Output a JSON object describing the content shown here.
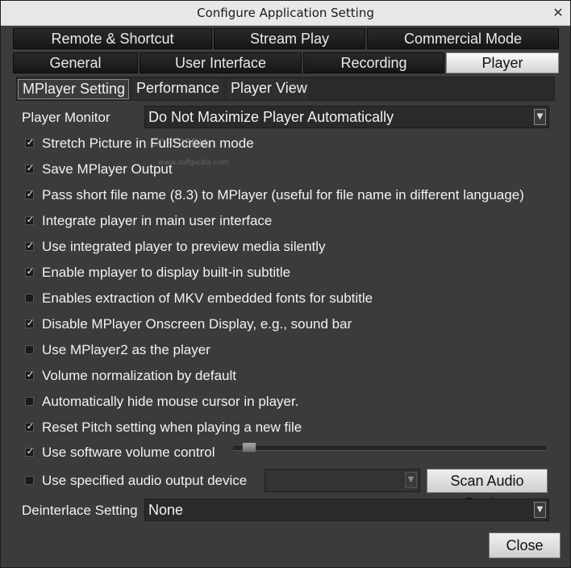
{
  "window": {
    "title": "Configure Application Setting",
    "close_glyph": "✕"
  },
  "tabs_row1": [
    "Remote & Shortcut",
    "Stream Play",
    "Commercial Mode"
  ],
  "tabs_row2": [
    "General",
    "User Interface",
    "Recording",
    "Player"
  ],
  "active_tab": "Player",
  "subtabs": [
    "MPlayer Setting",
    "Performance",
    "Player View"
  ],
  "active_subtab": "MPlayer Setting",
  "player_monitor": {
    "label": "Player Monitor",
    "value": "Do Not Maximize Player Automatically"
  },
  "options": [
    {
      "label": "Stretch Picture in FullScreen mode",
      "checked": true
    },
    {
      "label": "Save MPlayer Output",
      "checked": true
    },
    {
      "label": "Pass short file name (8.3) to MPlayer (useful for file name in different language)",
      "checked": true
    },
    {
      "label": "Integrate player in main user interface",
      "checked": true
    },
    {
      "label": "Use integrated player to preview media silently",
      "checked": true
    },
    {
      "label": "Enable mplayer to display built-in subtitle",
      "checked": true
    },
    {
      "label": "Enables extraction of MKV embedded fonts for subtitle",
      "checked": false
    },
    {
      "label": "Disable MPlayer Onscreen Display, e.g., sound bar",
      "checked": true
    },
    {
      "label": "Use MPlayer2 as the player",
      "checked": false
    },
    {
      "label": "Volume normalization by default",
      "checked": true
    },
    {
      "label": "Automatically hide mouse cursor in player.",
      "checked": false
    },
    {
      "label": "Reset Pitch setting when playing a new file",
      "checked": true
    }
  ],
  "software_volume": {
    "label": "Use software volume control",
    "checked": true,
    "level_fraction": 0.03
  },
  "audio_device": {
    "label": "Use specified audio output device",
    "checked": false,
    "value": "",
    "scan_button": "Scan Audio Device"
  },
  "deinterlace": {
    "label": "Deinterlace Setting",
    "value": "None"
  },
  "close_button": "Close",
  "watermark": {
    "main": "SOFTPEDIA",
    "url": "www.softpedia.com"
  },
  "icons": {
    "check": "✓",
    "dropdown": "▼"
  },
  "colors": {
    "background": "#3b3b3b",
    "tab_active": "#e0e0e0",
    "text": "#f2f2f2"
  }
}
